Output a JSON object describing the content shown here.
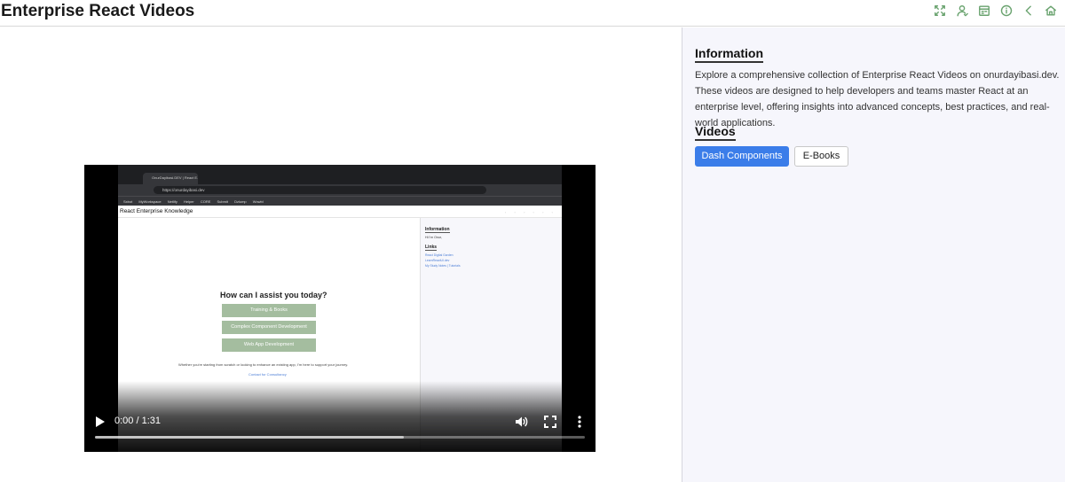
{
  "header": {
    "title": "Enterprise React Videos",
    "icons": [
      "expand-icon",
      "user-icon",
      "calendar-icon",
      "info-icon",
      "back-icon",
      "home-icon"
    ],
    "accent_color": "#6aa36f"
  },
  "video": {
    "time": "0:00 / 1:31",
    "buffered_fraction": 0.63,
    "frame": {
      "tab_title": "OnurDayibasi.DEV | React E...",
      "url": "https://onurdayibasi.dev",
      "bookmarks": "Sxbot MyWorkspace Netlify Helper CORE Submit Dzlump Wowbl",
      "app_title": "React Enterprise Knowledge",
      "side_information": "Information",
      "side_greeting": "Hi I'm Onur,",
      "side_links": "Links",
      "side_link_1": "React Digital Garden",
      "side_link_2": "LearnReactUI.dev",
      "side_link_3": "My Study Notes | Tutorials",
      "question": "How can I assist you today?",
      "button_1": "Training & Books",
      "button_2": "Complex Component Development",
      "button_3": "Web App Development",
      "footer": "Whether you're starting from scratch or looking to enhance an existing app, I'm here to support your journey.",
      "contact": "Contact for Consultancy"
    }
  },
  "sidebar": {
    "info_heading": "Information",
    "info_text": "Explore a comprehensive collection of Enterprise React Videos on onurdayibasi.dev. These videos are designed to help developers and teams master React at an enterprise level, offering insights into advanced concepts, best practices, and real-world applications.",
    "videos_heading": "Videos",
    "primary_button": "Dash Components",
    "secondary_button": "E-Books",
    "primary_color": "#3b7de9"
  }
}
